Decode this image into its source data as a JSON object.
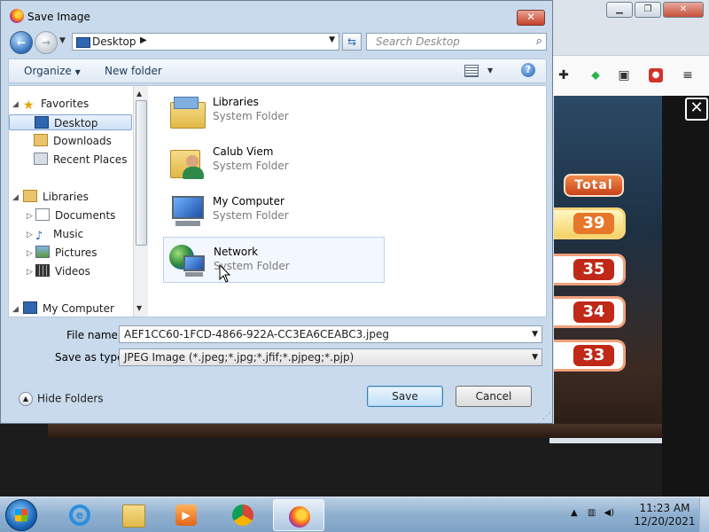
{
  "dialog": {
    "title": "Save Image",
    "address": {
      "location": "Desktop"
    },
    "search": {
      "placeholder": "Search Desktop"
    },
    "commandbar": {
      "organize": "Organize",
      "new_folder": "New folder"
    },
    "nav": {
      "favorites": "Favorites",
      "desktop": "Desktop",
      "downloads": "Downloads",
      "recent_places": "Recent Places",
      "libraries": "Libraries",
      "documents": "Documents",
      "music": "Music",
      "pictures": "Pictures",
      "videos": "Videos",
      "my_computer": "My Computer"
    },
    "items": [
      {
        "name": "Libraries",
        "type": "System Folder"
      },
      {
        "name": "Calub Viem",
        "type": "System Folder"
      },
      {
        "name": "My Computer",
        "type": "System Folder"
      },
      {
        "name": "Network",
        "type": "System Folder"
      }
    ],
    "file_name_label": "File name:",
    "file_name_value": "AEF1CC60-1FCD-4866-922A-CC3EA6CEABC3.jpeg",
    "save_type_label": "Save as type:",
    "save_type_value": "JPEG Image (*.jpeg;*.jpg;*.jfif;*.pjpeg;*.pjp)",
    "hide_folders": "Hide Folders",
    "save_button": "Save",
    "cancel_button": "Cancel"
  },
  "game": {
    "total_label": "Total",
    "scores": [
      "39",
      "35",
      "34",
      "33"
    ]
  },
  "taskbar": {
    "time": "11:23 AM",
    "date": "12/20/2021"
  },
  "colors": {
    "dialog_frame": "#c9daec",
    "accent_blue": "#2e6fb8",
    "score_red": "#c02818",
    "close_red": "#c5412b"
  }
}
